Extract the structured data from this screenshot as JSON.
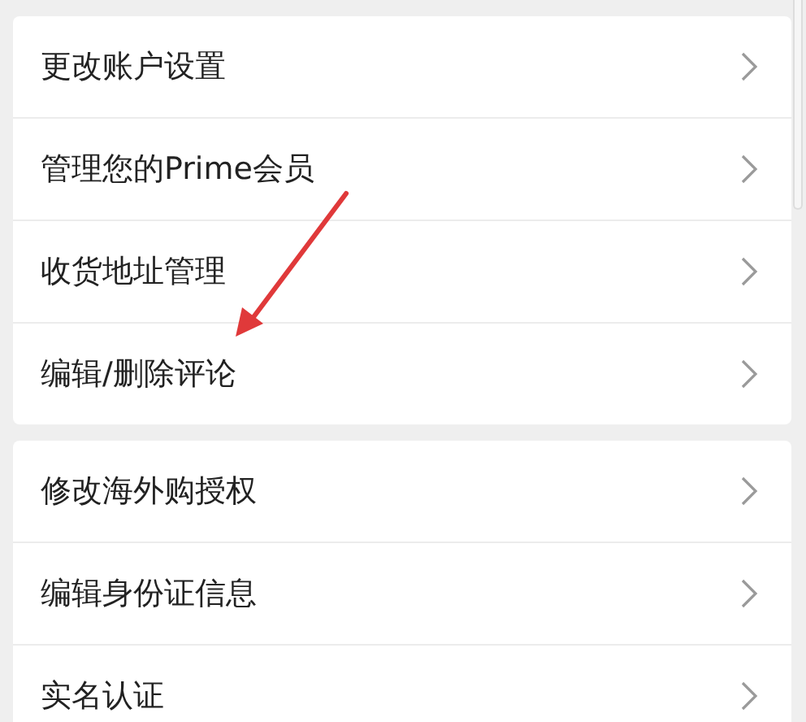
{
  "groups": [
    {
      "items": [
        {
          "label": "更改账户设置"
        },
        {
          "label": "管理您的Prime会员"
        },
        {
          "label": "收货地址管理"
        },
        {
          "label": "编辑/删除评论"
        }
      ]
    },
    {
      "items": [
        {
          "label": "修改海外购授权"
        },
        {
          "label": "编辑身份证信息"
        },
        {
          "label": "实名认证"
        }
      ]
    }
  ]
}
